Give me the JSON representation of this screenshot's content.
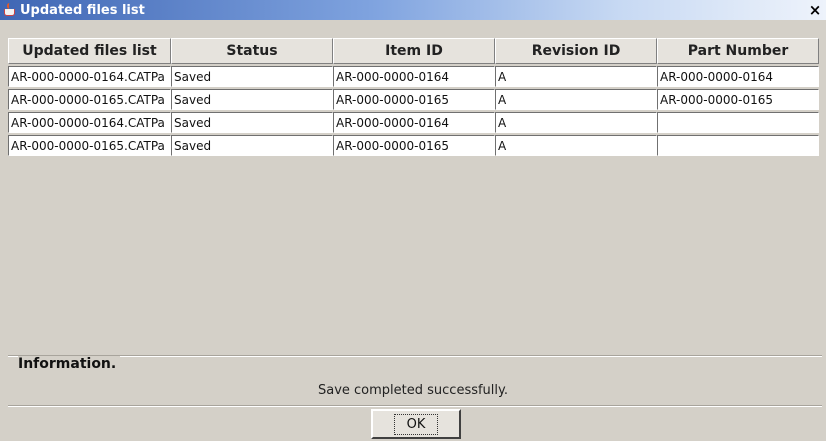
{
  "window": {
    "title": "Updated files list",
    "close_glyph": "×"
  },
  "table": {
    "columns": [
      "Updated files list",
      "Status",
      "Item ID",
      "Revision ID",
      "Part Number"
    ],
    "rows": [
      [
        "AR-000-0000-0164.CATPa",
        "Saved",
        "AR-000-0000-0164",
        "A",
        "AR-000-0000-0164"
      ],
      [
        "AR-000-0000-0165.CATPa",
        "Saved",
        "AR-000-0000-0165",
        "A",
        "AR-000-0000-0165"
      ],
      [
        "AR-000-0000-0164.CATPa",
        "Saved",
        "AR-000-0000-0164",
        "A",
        ""
      ],
      [
        "AR-000-0000-0165.CATPa",
        "Saved",
        "AR-000-0000-0165",
        "A",
        ""
      ]
    ]
  },
  "information": {
    "label": "Information.",
    "message": "Save completed successfully."
  },
  "buttons": {
    "ok_label": "OK"
  }
}
